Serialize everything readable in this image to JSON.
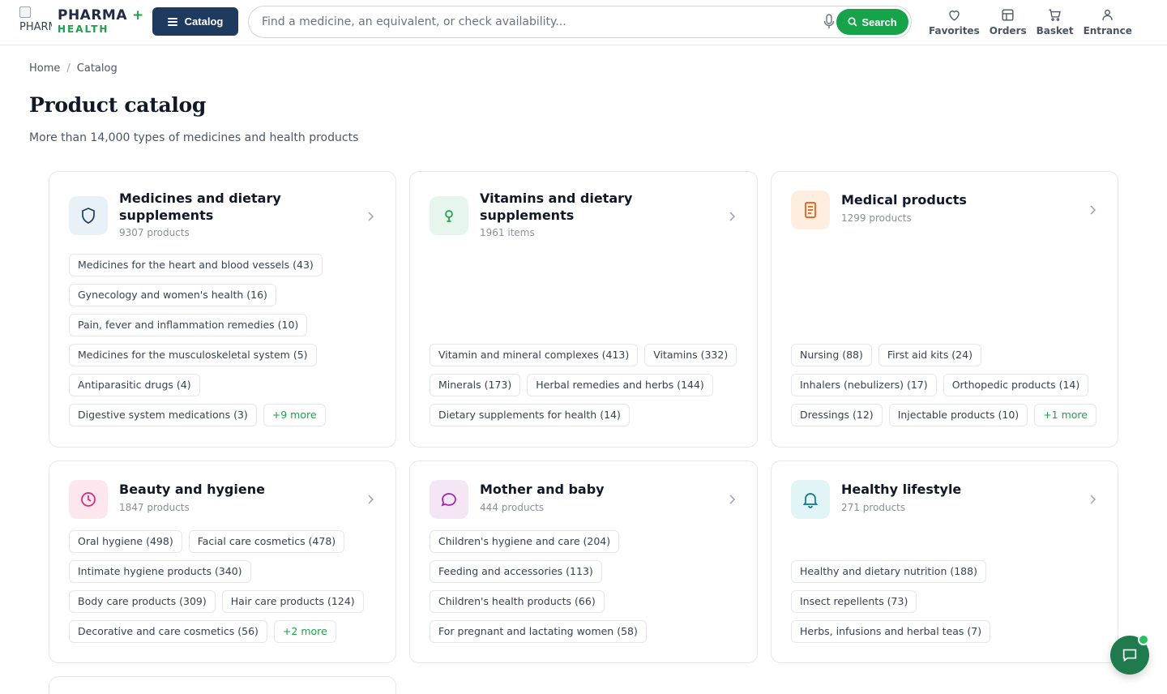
{
  "header": {
    "logo_alt": "PHARMA",
    "logo_main": "PHARMA",
    "logo_plus": "+",
    "logo_sub": "HEALTH",
    "catalog_label": "Catalog",
    "search_placeholder": "Find a medicine, an equivalent, or check availability...",
    "search_label": "Search",
    "nav": [
      {
        "label": "Favorites",
        "icon": "heart-icon"
      },
      {
        "label": "Orders",
        "icon": "orders-icon"
      },
      {
        "label": "Basket",
        "icon": "cart-icon"
      },
      {
        "label": "Entrance",
        "icon": "user-icon"
      }
    ]
  },
  "breadcrumb": {
    "home": "Home",
    "sep": "/",
    "current": "Catalog"
  },
  "page": {
    "title": "Product catalog",
    "subtitle": "More than 14,000 types of medicines and health products"
  },
  "colors": {
    "primary": "#1f3a5f",
    "accent": "#16a34a"
  },
  "cards": [
    {
      "title": "Medicines and dietary supplements",
      "count": "9307 products",
      "icon": "shield-icon",
      "icon_bg": "#e8f0f8",
      "icon_color": "#1f3a5f",
      "chips": [
        "Medicines for the heart and blood vessels (43)",
        "Gynecology and women's health (16)",
        "Pain, fever and inflammation remedies (10)",
        "Medicines for the musculoskeletal system (5)",
        "Antiparasitic drugs (4)",
        "Digestive system medications (3)"
      ],
      "more": "+9 more"
    },
    {
      "title": "Vitamins and dietary supplements",
      "count": "1961 items",
      "icon": "bulb-icon",
      "icon_bg": "#e6f6ec",
      "icon_color": "#16a34a",
      "chips": [
        "Vitamin and mineral complexes (413)",
        "Vitamins (332)",
        "Minerals (173)",
        "Herbal remedies and herbs (144)",
        "Dietary supplements for health (14)"
      ],
      "more": ""
    },
    {
      "title": "Medical products",
      "count": "1299 products",
      "icon": "document-icon",
      "icon_bg": "#fdeee0",
      "icon_color": "#ea580c",
      "chips": [
        "Nursing (88)",
        "First aid kits (24)",
        "Inhalers (nebulizers) (17)",
        "Orthopedic products (14)",
        "Dressings (12)",
        "Injectable products (10)"
      ],
      "more": "+1 more"
    },
    {
      "title": "Beauty and hygiene",
      "count": "1847 products",
      "icon": "clock-icon",
      "icon_bg": "#fce7ef",
      "icon_color": "#db2777",
      "chips": [
        "Oral hygiene (498)",
        "Facial care cosmetics (478)",
        "Intimate hygiene products (340)",
        "Body care products (309)",
        "Hair care products (124)",
        "Decorative and care cosmetics (56)"
      ],
      "more": "+2 more"
    },
    {
      "title": "Mother and baby",
      "count": "444 products",
      "icon": "chat-bubble-icon",
      "icon_bg": "#f4e6f4",
      "icon_color": "#a21caf",
      "chips": [
        "Children's hygiene and care (204)",
        "Feeding and accessories (113)",
        "Children's health products (66)",
        "For pregnant and lactating women (58)"
      ],
      "more": ""
    },
    {
      "title": "Healthy lifestyle",
      "count": "271 products",
      "icon": "bell-icon",
      "icon_bg": "#e2f5f6",
      "icon_color": "#0e7490",
      "chips": [
        "Healthy and dietary nutrition (188)",
        "Insect repellents (73)",
        "Herbs, infusions and herbal teas (7)"
      ],
      "more": ""
    }
  ]
}
